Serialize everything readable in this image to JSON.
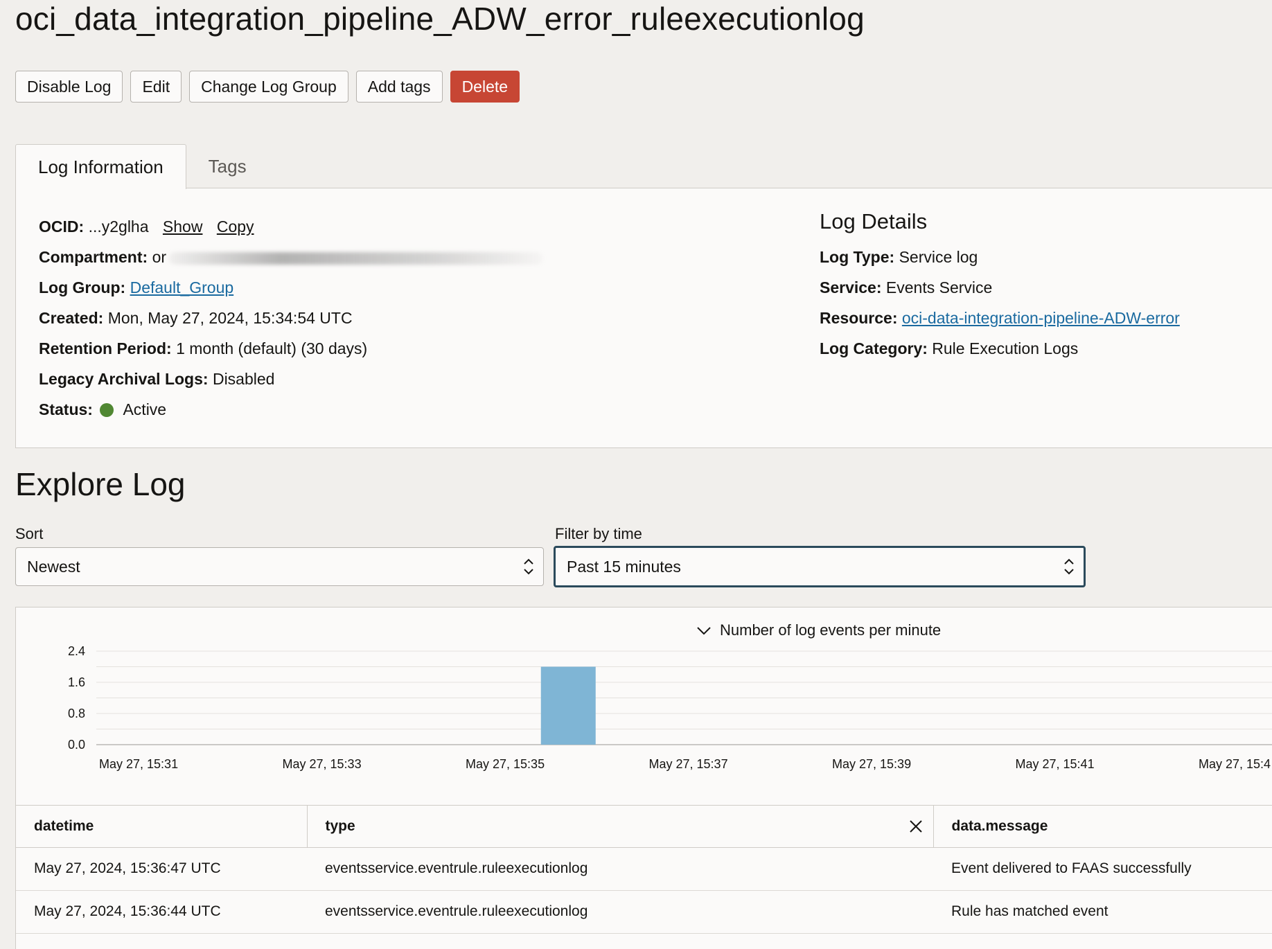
{
  "page": {
    "title": "oci_data_integration_pipeline_ADW_error_ruleexecutionlog"
  },
  "toolbar": {
    "disable_log": "Disable Log",
    "edit": "Edit",
    "change_log_group": "Change Log Group",
    "add_tags": "Add tags",
    "delete": "Delete",
    "delete_color": "#c74634"
  },
  "tabs": {
    "log_information": "Log Information",
    "tags": "Tags"
  },
  "log_info": {
    "ocid_label": "OCID:",
    "ocid_value": "...y2glha",
    "show": "Show",
    "copy": "Copy",
    "compartment_label": "Compartment:",
    "compartment_value": "or",
    "log_group_label": "Log Group:",
    "log_group_value": "Default_Group",
    "created_label": "Created:",
    "created_value": "Mon, May 27, 2024, 15:34:54 UTC",
    "retention_label": "Retention Period:",
    "retention_value": "1 month (default) (30 days)",
    "legacy_label": "Legacy Archival Logs:",
    "legacy_value": "Disabled",
    "status_label": "Status:",
    "status_value": "Active",
    "status_color": "#508732"
  },
  "log_details": {
    "title": "Log Details",
    "log_type_label": "Log Type:",
    "log_type_value": "Service log",
    "service_label": "Service:",
    "service_value": "Events Service",
    "resource_label": "Resource:",
    "resource_value": "oci-data-integration-pipeline-ADW-error",
    "category_label": "Log Category:",
    "category_value": "Rule Execution Logs"
  },
  "explore": {
    "title": "Explore Log",
    "sort_label": "Sort",
    "sort_value": "Newest",
    "filter_label": "Filter by time",
    "filter_value": "Past 15 minutes"
  },
  "chart_data": {
    "type": "bar",
    "title": "Number of log events per minute",
    "ylim": [
      0,
      2.4
    ],
    "yticks": [
      "2.4",
      "1.6",
      "0.8",
      "0.0"
    ],
    "xticks": [
      "May 27, 15:31",
      "May 27, 15:33",
      "May 27, 15:35",
      "May 27, 15:37",
      "May 27, 15:39",
      "May 27, 15:41",
      "May 27, 15:4"
    ],
    "bars": [
      {
        "x": "May 27, 15:36",
        "value": 2
      }
    ],
    "bar_color": "#7fb5d5",
    "grid": true
  },
  "table": {
    "headers": [
      "datetime",
      "type",
      "data.message"
    ],
    "rows": [
      [
        "May 27, 2024, 15:36:47 UTC",
        "eventsservice.eventrule.ruleexecutionlog",
        "Event delivered to FAAS successfully"
      ],
      [
        "May 27, 2024, 15:36:44 UTC",
        "eventsservice.eventrule.ruleexecutionlog",
        "Rule has matched event"
      ]
    ]
  }
}
